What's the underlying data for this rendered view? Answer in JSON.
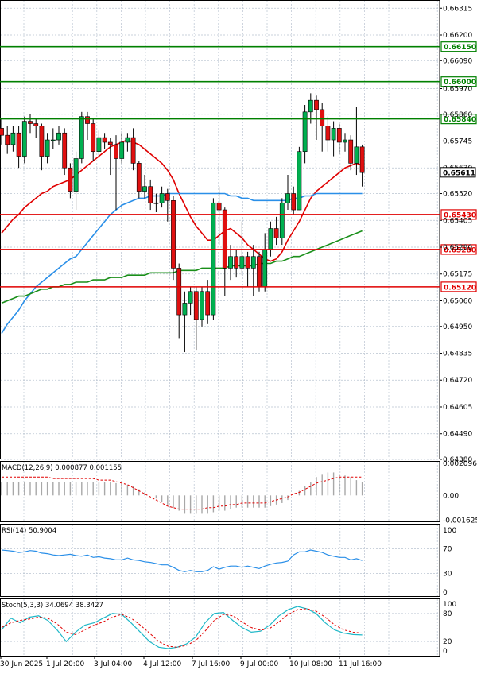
{
  "chart_data": {
    "type": "candlestick",
    "price_axis": {
      "ylim": [
        0.6438,
        0.6635
      ],
      "ticks": [
        "0.66315",
        "0.66200",
        "0.66090",
        "0.65970",
        "0.65860",
        "0.65745",
        "0.65630",
        "0.65520",
        "0.65405",
        "0.65290",
        "0.65175",
        "0.65060",
        "0.64950",
        "0.64835",
        "0.64720",
        "0.64605",
        "0.64490",
        "0.64380"
      ]
    },
    "time_labels": [
      "30 Jun 2025",
      "1 Jul 20:00",
      "3 Jul 04:00",
      "4 Jul 12:00",
      "7 Jul 16:00",
      "9 Jul 00:00",
      "10 Jul 08:00",
      "11 Jul 16:00"
    ],
    "levels": [
      {
        "label": "0.66150",
        "value": 0.6615,
        "color": "#008000"
      },
      {
        "label": "0.66000",
        "value": 0.66,
        "color": "#008000"
      },
      {
        "label": "0.65840",
        "value": 0.6584,
        "color": "#008000"
      },
      {
        "label": "0.65430",
        "value": 0.6543,
        "color": "#e00000"
      },
      {
        "label": "0.65280",
        "value": 0.6528,
        "color": "#e00000"
      },
      {
        "label": "0.65120",
        "value": 0.6512,
        "color": "#e00000"
      }
    ],
    "current_price": {
      "label": "0.65611",
      "value": 0.65611
    },
    "candles": [
      [
        0.658,
        0.6577,
        0.6584,
        0.6573
      ],
      [
        0.6577,
        0.6573,
        0.6581,
        0.6569
      ],
      [
        0.6573,
        0.6578,
        0.6581,
        0.657
      ],
      [
        0.6578,
        0.6568,
        0.6581,
        0.6563
      ],
      [
        0.6568,
        0.6583,
        0.6585,
        0.6565
      ],
      [
        0.6583,
        0.6582,
        0.6586,
        0.6578
      ],
      [
        0.6582,
        0.6581,
        0.6584,
        0.6576
      ],
      [
        0.6581,
        0.6568,
        0.6582,
        0.6562
      ],
      [
        0.6568,
        0.6575,
        0.6578,
        0.6565
      ],
      [
        0.6575,
        0.6575,
        0.658,
        0.6571
      ],
      [
        0.6575,
        0.6578,
        0.6581,
        0.6573
      ],
      [
        0.6578,
        0.6563,
        0.658,
        0.656
      ],
      [
        0.6563,
        0.6553,
        0.6565,
        0.655
      ],
      [
        0.6553,
        0.6567,
        0.657,
        0.6545
      ],
      [
        0.6567,
        0.6585,
        0.6587,
        0.6565
      ],
      [
        0.6585,
        0.6582,
        0.6587,
        0.6575
      ],
      [
        0.6582,
        0.657,
        0.6584,
        0.6566
      ],
      [
        0.657,
        0.6576,
        0.6579,
        0.6568
      ],
      [
        0.6576,
        0.6574,
        0.6578,
        0.6571
      ],
      [
        0.6574,
        0.6573,
        0.6576,
        0.656
      ],
      [
        0.6573,
        0.6567,
        0.6577,
        0.6545
      ],
      [
        0.6567,
        0.6574,
        0.6578,
        0.6565
      ],
      [
        0.6574,
        0.6576,
        0.6578,
        0.657
      ],
      [
        0.6576,
        0.6565,
        0.658,
        0.6562
      ],
      [
        0.6565,
        0.6553,
        0.6566,
        0.655
      ],
      [
        0.6553,
        0.6555,
        0.656,
        0.655
      ],
      [
        0.6555,
        0.6548,
        0.6558,
        0.6545
      ],
      [
        0.6548,
        0.6548,
        0.6552,
        0.6544
      ],
      [
        0.6548,
        0.6552,
        0.6555,
        0.6546
      ],
      [
        0.6552,
        0.6549,
        0.6554,
        0.654
      ],
      [
        0.6549,
        0.652,
        0.6551,
        0.6515
      ],
      [
        0.652,
        0.65,
        0.6522,
        0.649
      ],
      [
        0.65,
        0.6505,
        0.651,
        0.6484
      ],
      [
        0.6505,
        0.651,
        0.6512,
        0.65
      ],
      [
        0.651,
        0.6498,
        0.6512,
        0.6485
      ],
      [
        0.6498,
        0.651,
        0.6512,
        0.6495
      ],
      [
        0.651,
        0.65,
        0.6515,
        0.6496
      ],
      [
        0.65,
        0.6548,
        0.655,
        0.6498
      ],
      [
        0.6548,
        0.6545,
        0.6555,
        0.653
      ],
      [
        0.6545,
        0.652,
        0.6546,
        0.6508
      ],
      [
        0.652,
        0.6525,
        0.653,
        0.6515
      ],
      [
        0.6525,
        0.652,
        0.6528,
        0.6516
      ],
      [
        0.652,
        0.6525,
        0.654,
        0.6517
      ],
      [
        0.6525,
        0.652,
        0.6527,
        0.6512
      ],
      [
        0.652,
        0.6525,
        0.653,
        0.6508
      ],
      [
        0.6525,
        0.6512,
        0.6527,
        0.651
      ],
      [
        0.6512,
        0.6528,
        0.6535,
        0.651
      ],
      [
        0.6528,
        0.6537,
        0.654,
        0.6525
      ],
      [
        0.6537,
        0.6533,
        0.6542,
        0.653
      ],
      [
        0.6533,
        0.6548,
        0.655,
        0.653
      ],
      [
        0.6548,
        0.6552,
        0.656,
        0.6545
      ],
      [
        0.6552,
        0.6545,
        0.6555,
        0.6543
      ],
      [
        0.6545,
        0.657,
        0.6572,
        0.6545
      ],
      [
        0.657,
        0.6587,
        0.659,
        0.6565
      ],
      [
        0.6587,
        0.6592,
        0.6595,
        0.6582
      ],
      [
        0.6592,
        0.6588,
        0.6594,
        0.6575
      ],
      [
        0.6588,
        0.6581,
        0.6591,
        0.657
      ],
      [
        0.6581,
        0.6575,
        0.6585,
        0.657
      ],
      [
        0.6575,
        0.658,
        0.6583,
        0.6568
      ],
      [
        0.658,
        0.6574,
        0.6582,
        0.6569
      ],
      [
        0.6574,
        0.6575,
        0.6578,
        0.657
      ],
      [
        0.6575,
        0.6565,
        0.6577,
        0.6562
      ],
      [
        0.6565,
        0.6572,
        0.6589,
        0.656
      ],
      [
        0.6572,
        0.6561,
        0.6573,
        0.6555
      ]
    ],
    "overlays": [
      {
        "color": "#e00000",
        "values": [
          0.6535,
          0.6538,
          0.6541,
          0.6543,
          0.6546,
          0.6548,
          0.655,
          0.6552,
          0.6553,
          0.6555,
          0.6556,
          0.6557,
          0.6558,
          0.656,
          0.6562,
          0.6564,
          0.6566,
          0.6568,
          0.657,
          0.6572,
          0.6573,
          0.6574,
          0.6575,
          0.6574,
          0.6573,
          0.6571,
          0.6569,
          0.6567,
          0.6565,
          0.6562,
          0.6558,
          0.6552,
          0.6547,
          0.6542,
          0.6538,
          0.6535,
          0.6532,
          0.6532,
          0.6534,
          0.6536,
          0.6537,
          0.6535,
          0.6533,
          0.653,
          0.6528,
          0.6526,
          0.6524,
          0.6523,
          0.6524,
          0.6527,
          0.6532,
          0.6536,
          0.654,
          0.6545,
          0.655,
          0.6553,
          0.6555,
          0.6557,
          0.6559,
          0.6561,
          0.6563,
          0.6564,
          0.6565,
          0.6564
        ]
      },
      {
        "color": "#2a8fe8",
        "values": [
          0.6492,
          0.6496,
          0.6499,
          0.6502,
          0.6506,
          0.6509,
          0.6512,
          0.6514,
          0.6516,
          0.6518,
          0.652,
          0.6522,
          0.6524,
          0.6525,
          0.6528,
          0.6531,
          0.6534,
          0.6537,
          0.654,
          0.6543,
          0.6545,
          0.6547,
          0.6548,
          0.6549,
          0.655,
          0.655,
          0.6551,
          0.6551,
          0.6551,
          0.6552,
          0.6552,
          0.6552,
          0.6552,
          0.6552,
          0.6552,
          0.6552,
          0.6552,
          0.6552,
          0.6552,
          0.6552,
          0.6551,
          0.6551,
          0.655,
          0.655,
          0.6549,
          0.6549,
          0.6549,
          0.6549,
          0.6549,
          0.6549,
          0.6549,
          0.655,
          0.655,
          0.6551,
          0.6551,
          0.6552,
          0.6552,
          0.6552,
          0.6552,
          0.6552,
          0.6552,
          0.6552,
          0.6552,
          0.6552
        ]
      },
      {
        "color": "#1a8f1a",
        "values": [
          0.6505,
          0.6506,
          0.6507,
          0.6508,
          0.6508,
          0.6509,
          0.651,
          0.6511,
          0.6511,
          0.6512,
          0.6512,
          0.6513,
          0.6513,
          0.6514,
          0.6514,
          0.6514,
          0.6515,
          0.6515,
          0.6515,
          0.6516,
          0.6516,
          0.6516,
          0.6517,
          0.6517,
          0.6517,
          0.6517,
          0.6518,
          0.6518,
          0.6518,
          0.6518,
          0.6518,
          0.6519,
          0.6519,
          0.6519,
          0.6519,
          0.652,
          0.652,
          0.652,
          0.652,
          0.652,
          0.6521,
          0.6521,
          0.6521,
          0.6521,
          0.6521,
          0.6522,
          0.6522,
          0.6522,
          0.6523,
          0.6523,
          0.6524,
          0.6525,
          0.6525,
          0.6526,
          0.6527,
          0.6528,
          0.6529,
          0.653,
          0.6531,
          0.6532,
          0.6533,
          0.6534,
          0.6535,
          0.6536
        ]
      }
    ],
    "macd": {
      "label": "MACD(12,26,9) 0.000877 0.001155",
      "ylim": [
        -0.00175,
        0.00225
      ],
      "ticks": [
        "0.002096",
        "0.00",
        "-0.001625"
      ],
      "hist": [
        0.0009,
        0.0009,
        0.0009,
        0.0009,
        0.0009,
        0.0009,
        0.0009,
        0.0009,
        0.0009,
        0.0009,
        0.0009,
        0.0009,
        0.0009,
        0.0009,
        0.0009,
        0.0009,
        0.0009,
        0.0009,
        0.0009,
        0.0009,
        0.0008,
        0.0008,
        0.0007,
        0.0006,
        0.0004,
        0.0002,
        0.0,
        -0.0002,
        -0.0004,
        -0.0006,
        -0.0008,
        -0.001,
        -0.0012,
        -0.0012,
        -0.0012,
        -0.0012,
        -0.0012,
        -0.0011,
        -0.001,
        -0.001,
        -0.0009,
        -0.0008,
        -0.0008,
        -0.0008,
        -0.0008,
        -0.0008,
        -0.0008,
        -0.0007,
        -0.0006,
        -0.0005,
        -0.0003,
        0.0,
        0.0003,
        0.0006,
        0.0009,
        0.0012,
        0.0014,
        0.0015,
        0.0015,
        0.0014,
        0.0013,
        0.0012,
        0.001,
        0.0009
      ],
      "signal": [
        0.0012,
        0.0012,
        0.0012,
        0.0012,
        0.0012,
        0.0012,
        0.0012,
        0.0012,
        0.0012,
        0.0011,
        0.0011,
        0.0011,
        0.0011,
        0.0011,
        0.0011,
        0.0011,
        0.0011,
        0.001,
        0.001,
        0.001,
        0.0009,
        0.0008,
        0.0007,
        0.0005,
        0.0003,
        0.0001,
        -0.0001,
        -0.0003,
        -0.0005,
        -0.0007,
        -0.0008,
        -0.0009,
        -0.0009,
        -0.0009,
        -0.0009,
        -0.0009,
        -0.0008,
        -0.0008,
        -0.0007,
        -0.0007,
        -0.0006,
        -0.0006,
        -0.0005,
        -0.0005,
        -0.0005,
        -0.0005,
        -0.0005,
        -0.0004,
        -0.0003,
        -0.0002,
        -0.0001,
        0.0001,
        0.0002,
        0.0004,
        0.0006,
        0.0008,
        0.0009,
        0.001,
        0.0011,
        0.0012,
        0.0012,
        0.0012,
        0.0012,
        0.0012
      ]
    },
    "rsi": {
      "label": "RSI(14) 50.9004",
      "ylim": [
        0,
        100
      ],
      "ticks": [
        "100",
        "70",
        "30",
        "0"
      ],
      "values": [
        68,
        67,
        66,
        64,
        65,
        67,
        66,
        63,
        62,
        60,
        59,
        60,
        61,
        59,
        58,
        60,
        56,
        57,
        55,
        54,
        52,
        52,
        55,
        52,
        51,
        49,
        48,
        46,
        44,
        44,
        40,
        35,
        33,
        35,
        33,
        33,
        35,
        41,
        37,
        40,
        42,
        42,
        40,
        42,
        40,
        38,
        42,
        45,
        47,
        48,
        50,
        60,
        65,
        65,
        68,
        66,
        64,
        60,
        58,
        56,
        56,
        52,
        54,
        51
      ]
    },
    "stoch": {
      "label": "Stoch(5,3,3) 34.0694 38.3427",
      "ylim": [
        0,
        100
      ],
      "ticks": [
        "100",
        "80",
        "20",
        "0"
      ],
      "k": [
        45,
        70,
        60,
        72,
        75,
        65,
        45,
        20,
        40,
        55,
        60,
        70,
        80,
        78,
        60,
        40,
        20,
        8,
        5,
        8,
        15,
        30,
        60,
        80,
        82,
        65,
        50,
        40,
        42,
        55,
        75,
        88,
        95,
        90,
        80,
        60,
        45,
        38,
        35,
        34
      ],
      "d": [
        50,
        60,
        65,
        68,
        72,
        70,
        58,
        40,
        35,
        45,
        55,
        62,
        72,
        78,
        70,
        55,
        38,
        20,
        10,
        8,
        12,
        22,
        42,
        65,
        78,
        75,
        62,
        50,
        44,
        48,
        62,
        78,
        88,
        90,
        85,
        72,
        56,
        45,
        40,
        38
      ]
    }
  }
}
